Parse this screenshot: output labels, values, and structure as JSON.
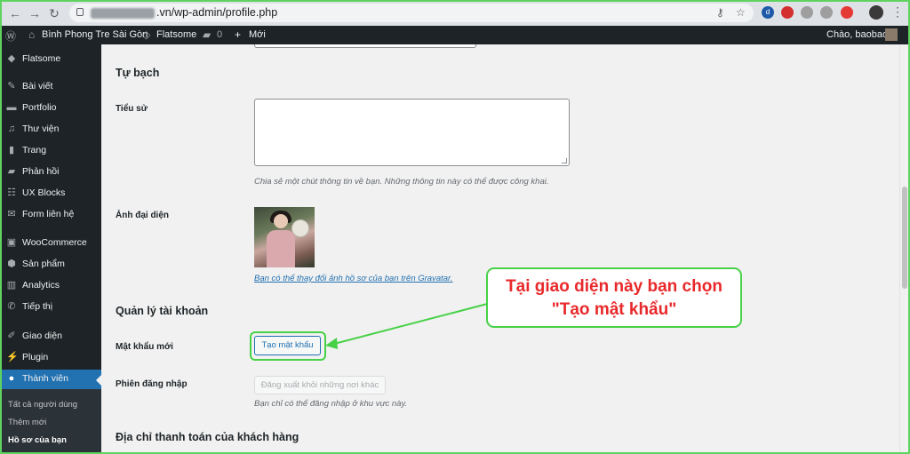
{
  "browser": {
    "url_visible": ".vn/wp-admin/profile.php",
    "back_icon": "back-arrow-icon",
    "forward_icon": "forward-arrow-icon",
    "reload_icon": "reload-icon"
  },
  "adminbar": {
    "site_name": "Bình Phong Tre Sài Gòn",
    "theme_name": "Flatsome",
    "comments_count": "0",
    "new_label": "Mới",
    "greeting": "Chào, baobao"
  },
  "sidebar": {
    "items": [
      {
        "label": "Flatsome",
        "icon": "flatsome-icon"
      },
      {
        "label": "Bài viết",
        "icon": "pin-icon"
      },
      {
        "label": "Portfolio",
        "icon": "folder-icon"
      },
      {
        "label": "Thư viện",
        "icon": "media-icon"
      },
      {
        "label": "Trang",
        "icon": "page-icon"
      },
      {
        "label": "Phản hồi",
        "icon": "comment-icon"
      },
      {
        "label": "UX Blocks",
        "icon": "blocks-icon"
      },
      {
        "label": "Form liên hệ",
        "icon": "mail-icon"
      },
      {
        "label": "WooCommerce",
        "icon": "woo-icon"
      },
      {
        "label": "Sản phẩm",
        "icon": "box-icon"
      },
      {
        "label": "Analytics",
        "icon": "chart-icon"
      },
      {
        "label": "Tiếp thị",
        "icon": "megaphone-icon"
      },
      {
        "label": "Giao diện",
        "icon": "brush-icon"
      },
      {
        "label": "Plugin",
        "icon": "plugin-icon"
      },
      {
        "label": "Thành viên",
        "icon": "user-icon"
      }
    ],
    "submenu": [
      {
        "label": "Tất cả người dùng"
      },
      {
        "label": "Thêm mới"
      },
      {
        "label": "Hồ sơ của bạn"
      }
    ]
  },
  "main": {
    "about_heading": "Tự bạch",
    "bio_label": "Tiểu sử",
    "bio_value": "",
    "bio_desc": "Chia sẻ một chút thông tin về bạn. Những thông tin này có thể được công khai.",
    "avatar_label": "Ảnh đại diện",
    "gravatar_link": "Bạn có thể thay đổi ảnh hồ sơ của bạn trên Gravatar",
    "gravatar_suffix": ".",
    "account_heading": "Quản lý tài khoản",
    "new_password_label": "Mật khẩu mới",
    "generate_password_button": "Tạo mật khẩu",
    "sessions_label": "Phiên đăng nhập",
    "logout_everywhere_button": "Đăng xuất khỏi những nơi khác",
    "sessions_desc": "Bạn chỉ có thể đăng nhập ở khu vực này.",
    "billing_heading": "Địa chỉ thanh toán của khách hàng"
  },
  "callout": {
    "line1": "Tại giao diện này bạn chọn",
    "line2": "\"Tạo mật khẩu\""
  },
  "colors": {
    "accent": "#2271b1",
    "admin_dark": "#1d2327",
    "highlight_green": "#47d147",
    "callout_red": "#e8292b"
  }
}
